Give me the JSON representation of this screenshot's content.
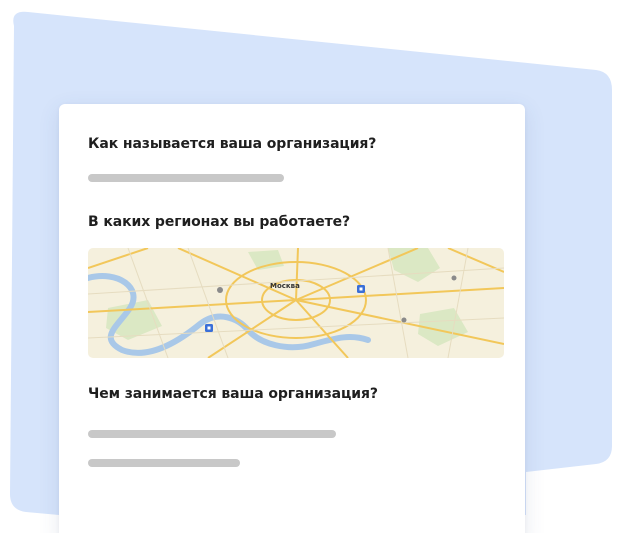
{
  "colors": {
    "background_shape": "#d6e4fb",
    "card": "#ffffff",
    "question_text": "#1f1f1f",
    "skeleton": "#c8c8c8",
    "map_land": "#f5f0dd",
    "map_roads": "#f2c75a",
    "map_river": "#a9c8e8",
    "map_parks": "#dbe8c4"
  },
  "form": {
    "question_name": "Как называется ваша организация?",
    "question_regions": "В каких регионах вы работаете?",
    "question_activity": "Чем занимается ваша организация?"
  },
  "map": {
    "city_label": "Москва",
    "marker_icon": "metro-station-icon"
  }
}
